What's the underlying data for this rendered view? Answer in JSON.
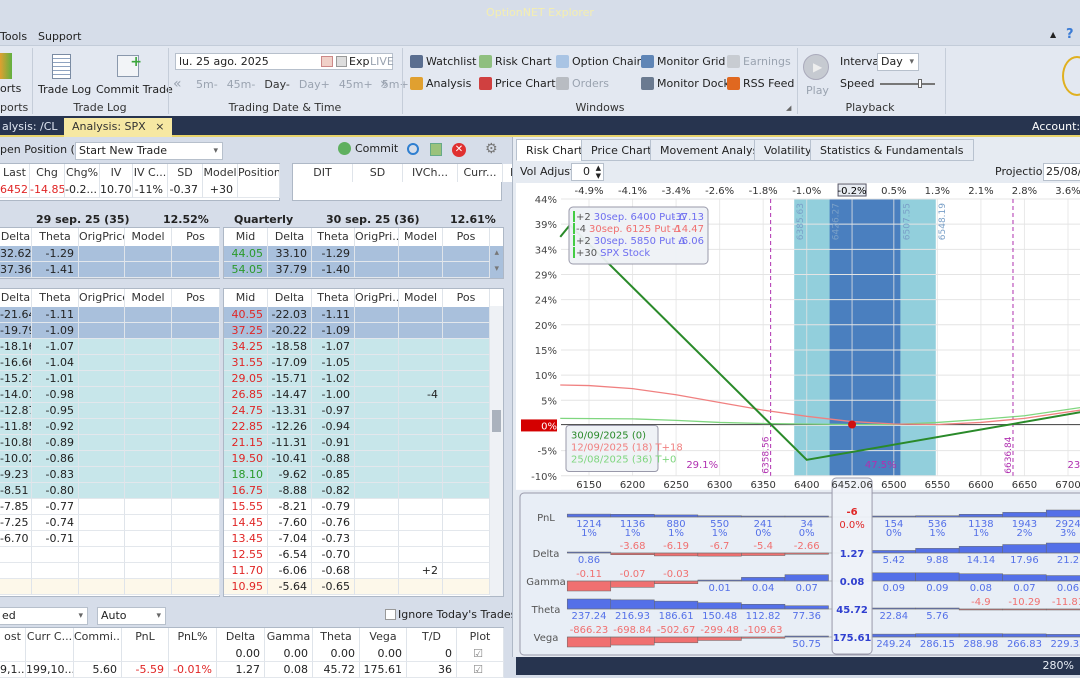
{
  "window": {
    "title": "OptionNET Explorer"
  },
  "menu": [
    "Tools",
    "Support"
  ],
  "ribbon": {
    "reports": {
      "label": "orts",
      "group": "ports"
    },
    "trade_log": {
      "trade_log": "Trade Log",
      "commit_trade": "Commit Trade",
      "group": "Trade Log"
    },
    "date": {
      "value": "lu. 25 ago. 2025",
      "exp": "Exp",
      "live": "LIVE",
      "steps": [
        "5m-",
        "45m-",
        "Day-",
        "Day+",
        "45m+",
        "5m+"
      ],
      "group": "Trading Date & Time"
    },
    "windows": {
      "items": [
        {
          "label": "Watchlist",
          "icon": "list-icon",
          "enabled": true
        },
        {
          "label": "Risk Chart",
          "icon": "risk-chart-icon",
          "enabled": true
        },
        {
          "label": "Option Chain",
          "icon": "table-icon",
          "enabled": true
        },
        {
          "label": "Monitor Grid",
          "icon": "monitor-icon",
          "enabled": true
        },
        {
          "label": "Earnings",
          "icon": "calendar-icon",
          "enabled": false
        },
        {
          "label": "Analysis",
          "icon": "sigma-icon",
          "enabled": true
        },
        {
          "label": "Price Chart",
          "icon": "candle-chart-icon",
          "enabled": true
        },
        {
          "label": "Orders",
          "icon": "orders-icon",
          "enabled": false
        },
        {
          "label": "Monitor Dock",
          "icon": "eye-icon",
          "enabled": true
        },
        {
          "label": "RSS Feed",
          "icon": "rss-icon",
          "enabled": true
        }
      ],
      "group": "Windows"
    },
    "playback": {
      "play": "Play",
      "interval_label": "Interval",
      "interval": "Day",
      "speed_label": "Speed",
      "group": "Playback"
    }
  },
  "doc_tabs": [
    {
      "label": "alysis: /CL"
    },
    {
      "label": "Analysis: SPX",
      "close": "×"
    }
  ],
  "account": "Account: E",
  "left": {
    "open_position": "pen Position (0)",
    "trade_select": "Start New Trade",
    "commit": "Commit",
    "quote_headers": [
      "Last",
      "Chg",
      "Chg%",
      "IV",
      "IV C...",
      "SD",
      "Model",
      "Position"
    ],
    "quote_row": [
      "6452...",
      "-14.85",
      "-0.2...",
      "10.70",
      "-11%",
      "-0.37",
      "+30",
      ""
    ],
    "pos_headers": [
      "DIT",
      "SD",
      "IVCh...",
      "Curr...",
      "PnL%"
    ],
    "calls_left": {
      "expiry": "29 sep. 25 (35)",
      "iv": "12.52%",
      "headers": [
        "Delta",
        "Theta",
        "OrigPrice",
        "Model",
        "Pos"
      ],
      "rows": [
        [
          "32.62",
          "-1.29",
          "",
          "",
          ""
        ],
        [
          "37.36",
          "-1.41",
          "",
          "",
          ""
        ]
      ]
    },
    "calls_right": {
      "type": "Quarterly",
      "expiry": "30 sep. 25 (36)",
      "iv": "12.61%",
      "headers": [
        "Mid",
        "Delta",
        "Theta",
        "OrigPri...",
        "Model",
        "Pos"
      ],
      "rows": [
        [
          "44.05",
          "33.10",
          "-1.29",
          "",
          "",
          ""
        ],
        [
          "54.05",
          "37.79",
          "-1.40",
          "",
          "",
          ""
        ]
      ]
    },
    "puts_left": {
      "headers": [
        "Delta",
        "Theta",
        "OrigPrice",
        "Model",
        "Pos"
      ],
      "rows": [
        [
          "-21.64",
          "-1.11"
        ],
        [
          "-19.79",
          "-1.09"
        ],
        [
          "-18.16",
          "-1.07"
        ],
        [
          "-16.66",
          "-1.04"
        ],
        [
          "-15.27",
          "-1.01"
        ],
        [
          "-14.01",
          "-0.98"
        ],
        [
          "-12.87",
          "-0.95"
        ],
        [
          "-11.85",
          "-0.92"
        ],
        [
          "-10.88",
          "-0.89"
        ],
        [
          "-10.02",
          "-0.86"
        ],
        [
          "-9.23",
          "-0.83"
        ],
        [
          "-8.51",
          "-0.80"
        ],
        [
          "-7.85",
          "-0.77"
        ],
        [
          "-7.25",
          "-0.74"
        ],
        [
          "-6.70",
          "-0.71"
        ],
        [
          "",
          ""
        ],
        [
          "",
          ""
        ],
        [
          "",
          ""
        ]
      ]
    },
    "puts_right": {
      "headers": [
        "Mid",
        "Delta",
        "Theta",
        "OrigPri...",
        "Model",
        "Pos"
      ],
      "rows": [
        [
          "40.55",
          "-22.03",
          "-1.11",
          ""
        ],
        [
          "37.25",
          "-20.22",
          "-1.09",
          ""
        ],
        [
          "34.25",
          "-18.58",
          "-1.07",
          ""
        ],
        [
          "31.55",
          "-17.09",
          "-1.05",
          ""
        ],
        [
          "29.05",
          "-15.71",
          "-1.02",
          ""
        ],
        [
          "26.85",
          "-14.47",
          "-1.00",
          "-4"
        ],
        [
          "24.75",
          "-13.31",
          "-0.97",
          ""
        ],
        [
          "22.85",
          "-12.26",
          "-0.94",
          ""
        ],
        [
          "21.15",
          "-11.31",
          "-0.91",
          ""
        ],
        [
          "19.50",
          "-10.41",
          "-0.88",
          ""
        ],
        [
          "18.10",
          "-9.62",
          "-0.85",
          ""
        ],
        [
          "16.75",
          "-8.88",
          "-0.82",
          ""
        ],
        [
          "15.55",
          "-8.21",
          "-0.79",
          ""
        ],
        [
          "14.45",
          "-7.60",
          "-0.76",
          ""
        ],
        [
          "13.45",
          "-7.04",
          "-0.73",
          ""
        ],
        [
          "12.55",
          "-6.54",
          "-0.70",
          ""
        ],
        [
          "11.70",
          "-6.06",
          "-0.68",
          "+2"
        ],
        [
          "10.95",
          "-5.64",
          "-0.65",
          ""
        ]
      ],
      "mid_colors": [
        "red",
        "red",
        "red",
        "red",
        "red",
        "red",
        "red",
        "red",
        "red",
        "red",
        "green",
        "red",
        "red",
        "red",
        "red",
        "red",
        "red",
        "red"
      ]
    },
    "row_states": [
      "selected",
      "selected",
      "range",
      "range",
      "range",
      "range",
      "range",
      "range",
      "range",
      "range",
      "range",
      "range",
      "normal",
      "normal",
      "normal",
      "normal",
      "normal",
      "current"
    ],
    "bottom": {
      "select1": "ed",
      "select2": "Auto",
      "ignore_label": "Ignore Today's Trades",
      "ignore_checked": false,
      "headers": [
        "ost",
        "Curr C...",
        "Commi...",
        "PnL",
        "PnL%",
        "Delta",
        "Gamma",
        "Theta",
        "Vega",
        "T/D",
        "Plot"
      ],
      "rows": [
        [
          "",
          "",
          "",
          "",
          "",
          "0.00",
          "0.00",
          "0.00",
          "0.00",
          "0",
          true
        ],
        [
          "9,1...",
          "199,10...",
          "5.60",
          "-5.59",
          "-0.01%",
          "1.27",
          "0.08",
          "45.72",
          "175.61",
          "36",
          true
        ]
      ]
    }
  },
  "right": {
    "tabs": [
      "Risk Chart",
      "Price Chart",
      "Movement Analysis",
      "Volatility",
      "Statistics & Fundamentals"
    ],
    "active_tab": "Risk Chart",
    "vol_adjust_label": "Vol Adjust",
    "vol_adjust": "0",
    "projection_label": "Projection",
    "projection": "25/08/2",
    "zoom": "280%"
  },
  "chart_data": {
    "type": "line",
    "xlim": [
      6117,
      6714
    ],
    "ylim": [
      -10,
      44
    ],
    "x_ticks": [
      6150,
      6200,
      6250,
      6300,
      6350,
      6400,
      6500,
      6550,
      6600,
      6650,
      6700
    ],
    "y_tick_labels": [
      "44%",
      "39%",
      "34%",
      "29%",
      "24%",
      "20%",
      "15%",
      "10%",
      "5%",
      "0%",
      "-5%",
      "-10%"
    ],
    "top_pct_labels": [
      "-4.9%",
      "-4.1%",
      "-3.4%",
      "-2.6%",
      "-1.8%",
      "-1.0%",
      "0.5%",
      "1.3%",
      "2.1%",
      "2.8%",
      "3.6%"
    ],
    "current_price": 6452.06,
    "current_price_label": "6452.06",
    "current_pct_label": "-0.2%",
    "sd_bands": {
      "outer": [
        6385.63,
        6548.19
      ],
      "inner": [
        6426.27,
        6507.55
      ],
      "labels": [
        "6385.63",
        "6426.27",
        "6507.55",
        "6548.19"
      ]
    },
    "breakevens": [
      {
        "x": 6358.56,
        "label": "6358.56"
      },
      {
        "x": 6636.84,
        "label": "6636.84"
      }
    ],
    "probability_labels": [
      {
        "x": 6280,
        "label": "29.1%"
      },
      {
        "x": 6485,
        "label": "47.5%"
      },
      {
        "x": 6714,
        "label": "23"
      }
    ],
    "series": [
      {
        "name": "30/09/2025 (0)",
        "color": "#2a8a2a",
        "points": [
          [
            6117,
            36.6
          ],
          [
            6128,
            38.9
          ],
          [
            6400,
            -6.9
          ],
          [
            6714,
            2.4
          ]
        ]
      },
      {
        "name": "12/09/2025 (18) T+18",
        "color": "#f08080",
        "points": [
          [
            6117,
            7.7
          ],
          [
            6150,
            7.6
          ],
          [
            6200,
            7.0
          ],
          [
            6250,
            5.8
          ],
          [
            6300,
            4.3
          ],
          [
            6350,
            2.8
          ],
          [
            6400,
            1.6
          ],
          [
            6450,
            0.6
          ],
          [
            6500,
            0.1
          ],
          [
            6550,
            0.0
          ],
          [
            6600,
            0.4
          ],
          [
            6650,
            1.2
          ],
          [
            6714,
            2.8
          ]
        ]
      },
      {
        "name": "25/08/2025 (36) T+0",
        "color": "#7fd67f",
        "points": [
          [
            6117,
            1.2
          ],
          [
            6200,
            1.1
          ],
          [
            6250,
            0.8
          ],
          [
            6300,
            0.4
          ],
          [
            6350,
            0.2
          ],
          [
            6400,
            0.1
          ],
          [
            6450,
            0.0
          ],
          [
            6500,
            0.0
          ],
          [
            6550,
            0.4
          ],
          [
            6600,
            1.0
          ],
          [
            6650,
            1.7
          ],
          [
            6714,
            3.3
          ]
        ]
      }
    ],
    "position_legend": [
      {
        "qty": "+2",
        "text": "30sep. 6400 Put Δ",
        "delta": "-37.13",
        "color": "#6e6ef0"
      },
      {
        "qty": "-4",
        "text": "30sep. 6125 Put Δ",
        "delta": "-14.47",
        "color": "#f07070"
      },
      {
        "qty": "+2",
        "text": "30sep. 5850 Put Δ",
        "delta": "-6.06",
        "color": "#6e6ef0"
      },
      {
        "qty": "+30",
        "text": "SPX Stock",
        "delta": "",
        "color": "#6e6ef0"
      }
    ],
    "greeks": {
      "strikes": [
        6150,
        6200,
        6250,
        6300,
        6350,
        6400,
        6500,
        6550,
        6600,
        6650,
        6700
      ],
      "rows": [
        {
          "name": "PnL",
          "values": [
            1214,
            1136,
            880,
            550,
            241,
            34,
            154,
            536,
            1138,
            1943,
            2924
          ],
          "pct": [
            "1%",
            "1%",
            "1%",
            "1%",
            "0%",
            "0%",
            "0%",
            "1%",
            "1%",
            "2%",
            "3%"
          ],
          "current": "-6",
          "current_pct": "0.0%"
        },
        {
          "name": "Delta",
          "values": [
            0.86,
            -3.68,
            -6.19,
            -6.7,
            -5.4,
            -2.66,
            5.42,
            9.88,
            14.14,
            17.96,
            21.2
          ],
          "current": "1.27"
        },
        {
          "name": "Gamma",
          "values": [
            -0.11,
            -0.07,
            -0.03,
            0.01,
            0.04,
            0.07,
            0.09,
            0.09,
            0.08,
            0.07,
            0.06
          ],
          "current": "0.08"
        },
        {
          "name": "Theta",
          "values": [
            237.24,
            216.93,
            186.61,
            150.48,
            112.82,
            77.36,
            22.84,
            5.76,
            -4.9,
            -10.29,
            -11.81
          ],
          "current": "45.72"
        },
        {
          "name": "Vega",
          "values": [
            -866.23,
            -698.84,
            -502.67,
            -299.48,
            -109.63,
            50.75,
            249.24,
            286.15,
            288.98,
            266.83,
            229.32
          ],
          "current": "175.61"
        }
      ]
    },
    "colors": {
      "positive": "#5470e8",
      "negative": "#f07070",
      "band_outer": "#92cfdc",
      "band_inner": "#4a7fbf",
      "breakeven": "#b030b0"
    }
  }
}
